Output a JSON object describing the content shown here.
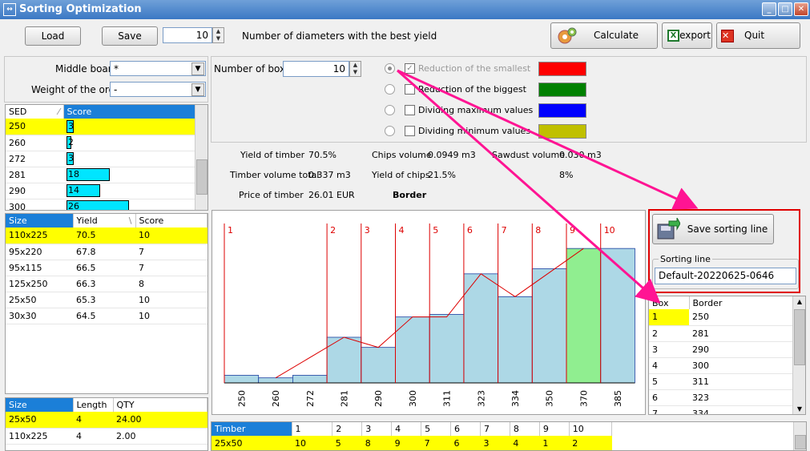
{
  "window": {
    "title": "Sorting Optimization",
    "min": "_",
    "max": "□",
    "close": "✕"
  },
  "toolbar": {
    "load": "Load",
    "save": "Save",
    "diameters_value": "10",
    "diameters_label": "Number of diameters with the best yield",
    "calculate": "Calculate",
    "export": "export",
    "quit": "Quit"
  },
  "filters": {
    "middle_board_label": "Middle board",
    "middle_board_value": "*",
    "weight_label": "Weight of the order",
    "weight_value": "-"
  },
  "sed_table": {
    "headers": [
      "SED",
      "Score"
    ],
    "rows": [
      {
        "sed": "250",
        "score": 3,
        "score_text": "3"
      },
      {
        "sed": "260",
        "score": 2,
        "score_text": "2"
      },
      {
        "sed": "272",
        "score": 3,
        "score_text": "3"
      },
      {
        "sed": "281",
        "score": 18,
        "score_text": "18"
      },
      {
        "sed": "290",
        "score": 14,
        "score_text": "14"
      },
      {
        "sed": "300",
        "score": 26,
        "score_text": "26"
      }
    ]
  },
  "size_table": {
    "headers": [
      "Size",
      "Yield",
      "Score"
    ],
    "rows": [
      [
        "110x225",
        "70.5",
        "10"
      ],
      [
        "95x220",
        "67.8",
        "7"
      ],
      [
        "95x115",
        "66.5",
        "7"
      ],
      [
        "125x250",
        "66.3",
        "8"
      ],
      [
        "25x50",
        "65.3",
        "10"
      ],
      [
        "30x30",
        "64.5",
        "10"
      ]
    ]
  },
  "order_table": {
    "headers": [
      "Size",
      "Length",
      "QTY"
    ],
    "rows": [
      [
        "25x50",
        "4",
        "24.00"
      ],
      [
        "110x225",
        "4",
        "2.00"
      ]
    ]
  },
  "boxes": {
    "label": "Number of boxes",
    "value": "10"
  },
  "options": [
    {
      "label": "Reduction of the smallest",
      "color": "#ff0000",
      "checked": true,
      "disabled": true
    },
    {
      "label": "Reduction of the biggest",
      "color": "#008000"
    },
    {
      "label": "Dividing maximum values",
      "color": "#0000ff"
    },
    {
      "label": "Dividing minimum values",
      "color": "#c0c000"
    }
  ],
  "stats": {
    "yield_timber_label": "Yield of timber",
    "yield_timber": "70.5%",
    "timber_volume_label": "Timber volume total",
    "timber_volume": "0.337 m3",
    "price_label": "Price of timber",
    "price": "26.01 EUR",
    "chips_volume_label": "Chips volume",
    "chips_volume": "0.0949 m3",
    "yield_chips_label": "Yield of chips",
    "yield_chips": "21.5%",
    "border_label": "Border",
    "sawdust_label": "Sawdust volume",
    "sawdust": "0.030 m3",
    "sawdust_pct": "8%"
  },
  "chart_data": {
    "type": "bar",
    "categories": [
      "250",
      "260",
      "272",
      "281",
      "290",
      "300",
      "311",
      "323",
      "334",
      "350",
      "370",
      "385"
    ],
    "values": [
      3,
      2,
      3,
      18,
      14,
      26,
      27,
      43,
      34,
      45,
      53,
      53
    ],
    "line_values": [
      null,
      2,
      null,
      18,
      14,
      26,
      26,
      43,
      34,
      null,
      53,
      null
    ],
    "box_numbers": [
      "1",
      "2",
      "3",
      "4",
      "5",
      "6",
      "7",
      "8",
      "9",
      "10"
    ],
    "box_starts": [
      0,
      3,
      4,
      5,
      6,
      7,
      8,
      9,
      10,
      11
    ],
    "highlight_index": 10,
    "ylim": [
      0,
      60
    ],
    "grid": false
  },
  "sorting": {
    "save_label": "Save sorting line",
    "line_label": "Sorting line",
    "line_value": "Default-20220625-0646"
  },
  "box_table": {
    "headers": [
      "Box",
      "Border"
    ],
    "rows": [
      [
        "1",
        "250"
      ],
      [
        "2",
        "281"
      ],
      [
        "3",
        "290"
      ],
      [
        "4",
        "300"
      ],
      [
        "5",
        "311"
      ],
      [
        "6",
        "323"
      ],
      [
        "7",
        "334"
      ]
    ]
  },
  "timber_table": {
    "headers": [
      "Timber",
      "1",
      "2",
      "3",
      "4",
      "5",
      "6",
      "7",
      "8",
      "9",
      "10"
    ],
    "rows": [
      [
        "25x50",
        "10",
        "5",
        "8",
        "9",
        "7",
        "6",
        "3",
        "4",
        "1",
        "2"
      ]
    ]
  }
}
